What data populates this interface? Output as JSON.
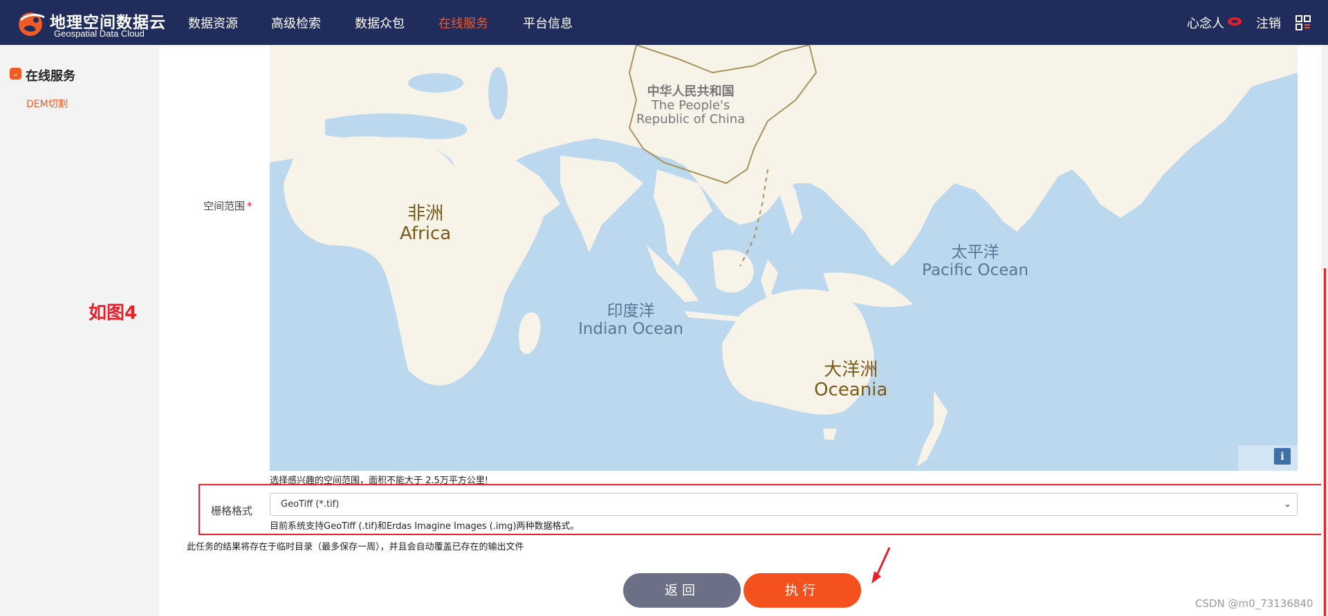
{
  "header": {
    "logo_cn": "地理空间数据云",
    "logo_en": "Geospatial Data Cloud",
    "nav": [
      {
        "label": "数据资源"
      },
      {
        "label": "高级检索"
      },
      {
        "label": "数据众包"
      },
      {
        "label": "在线服务",
        "active": true
      },
      {
        "label": "平台信息"
      }
    ],
    "user_name": "心念人",
    "logout_label": "注销",
    "active_color": "#f05a24",
    "bar_color": "#1f2c5c"
  },
  "sidebar": {
    "section_title": "在线服务",
    "items": [
      {
        "label": "DEM切割"
      }
    ]
  },
  "annotation": {
    "figure_label": "如图4"
  },
  "form": {
    "extent": {
      "label": "空间范围",
      "required_mark": "*",
      "hint": "选择感兴趣的空间范围，面积不能大于 2.5万平方公里!"
    },
    "format": {
      "label": "栅格格式",
      "selected": "GeoTiff (*.tif)",
      "hint": "目前系统支持GeoTiff (.tif)和Erdas Imagine Images (.img)两种数据格式。"
    },
    "notice": "此任务的结果将存在于临时目录（最多保存一周），并且会自动覆盖已存在的输出文件",
    "back_label": "返回",
    "run_label": "执行"
  },
  "map": {
    "labels": {
      "china": {
        "cn": "中华人民共和国",
        "en1": "The People's",
        "en2": "Republic of China"
      },
      "africa": {
        "cn": "非洲",
        "en": "Africa"
      },
      "indian_ocean": {
        "cn": "印度洋",
        "en": "Indian Ocean"
      },
      "pacific_ocean": {
        "cn": "太平洋",
        "en": "Pacific Ocean"
      },
      "oceania": {
        "cn": "大洋洲",
        "en": "Oceania"
      }
    },
    "info_button": "i",
    "ocean_color": "#bcd8ef",
    "land_color": "#f7f3e8"
  },
  "watermark": "CSDN @m0_73136840"
}
